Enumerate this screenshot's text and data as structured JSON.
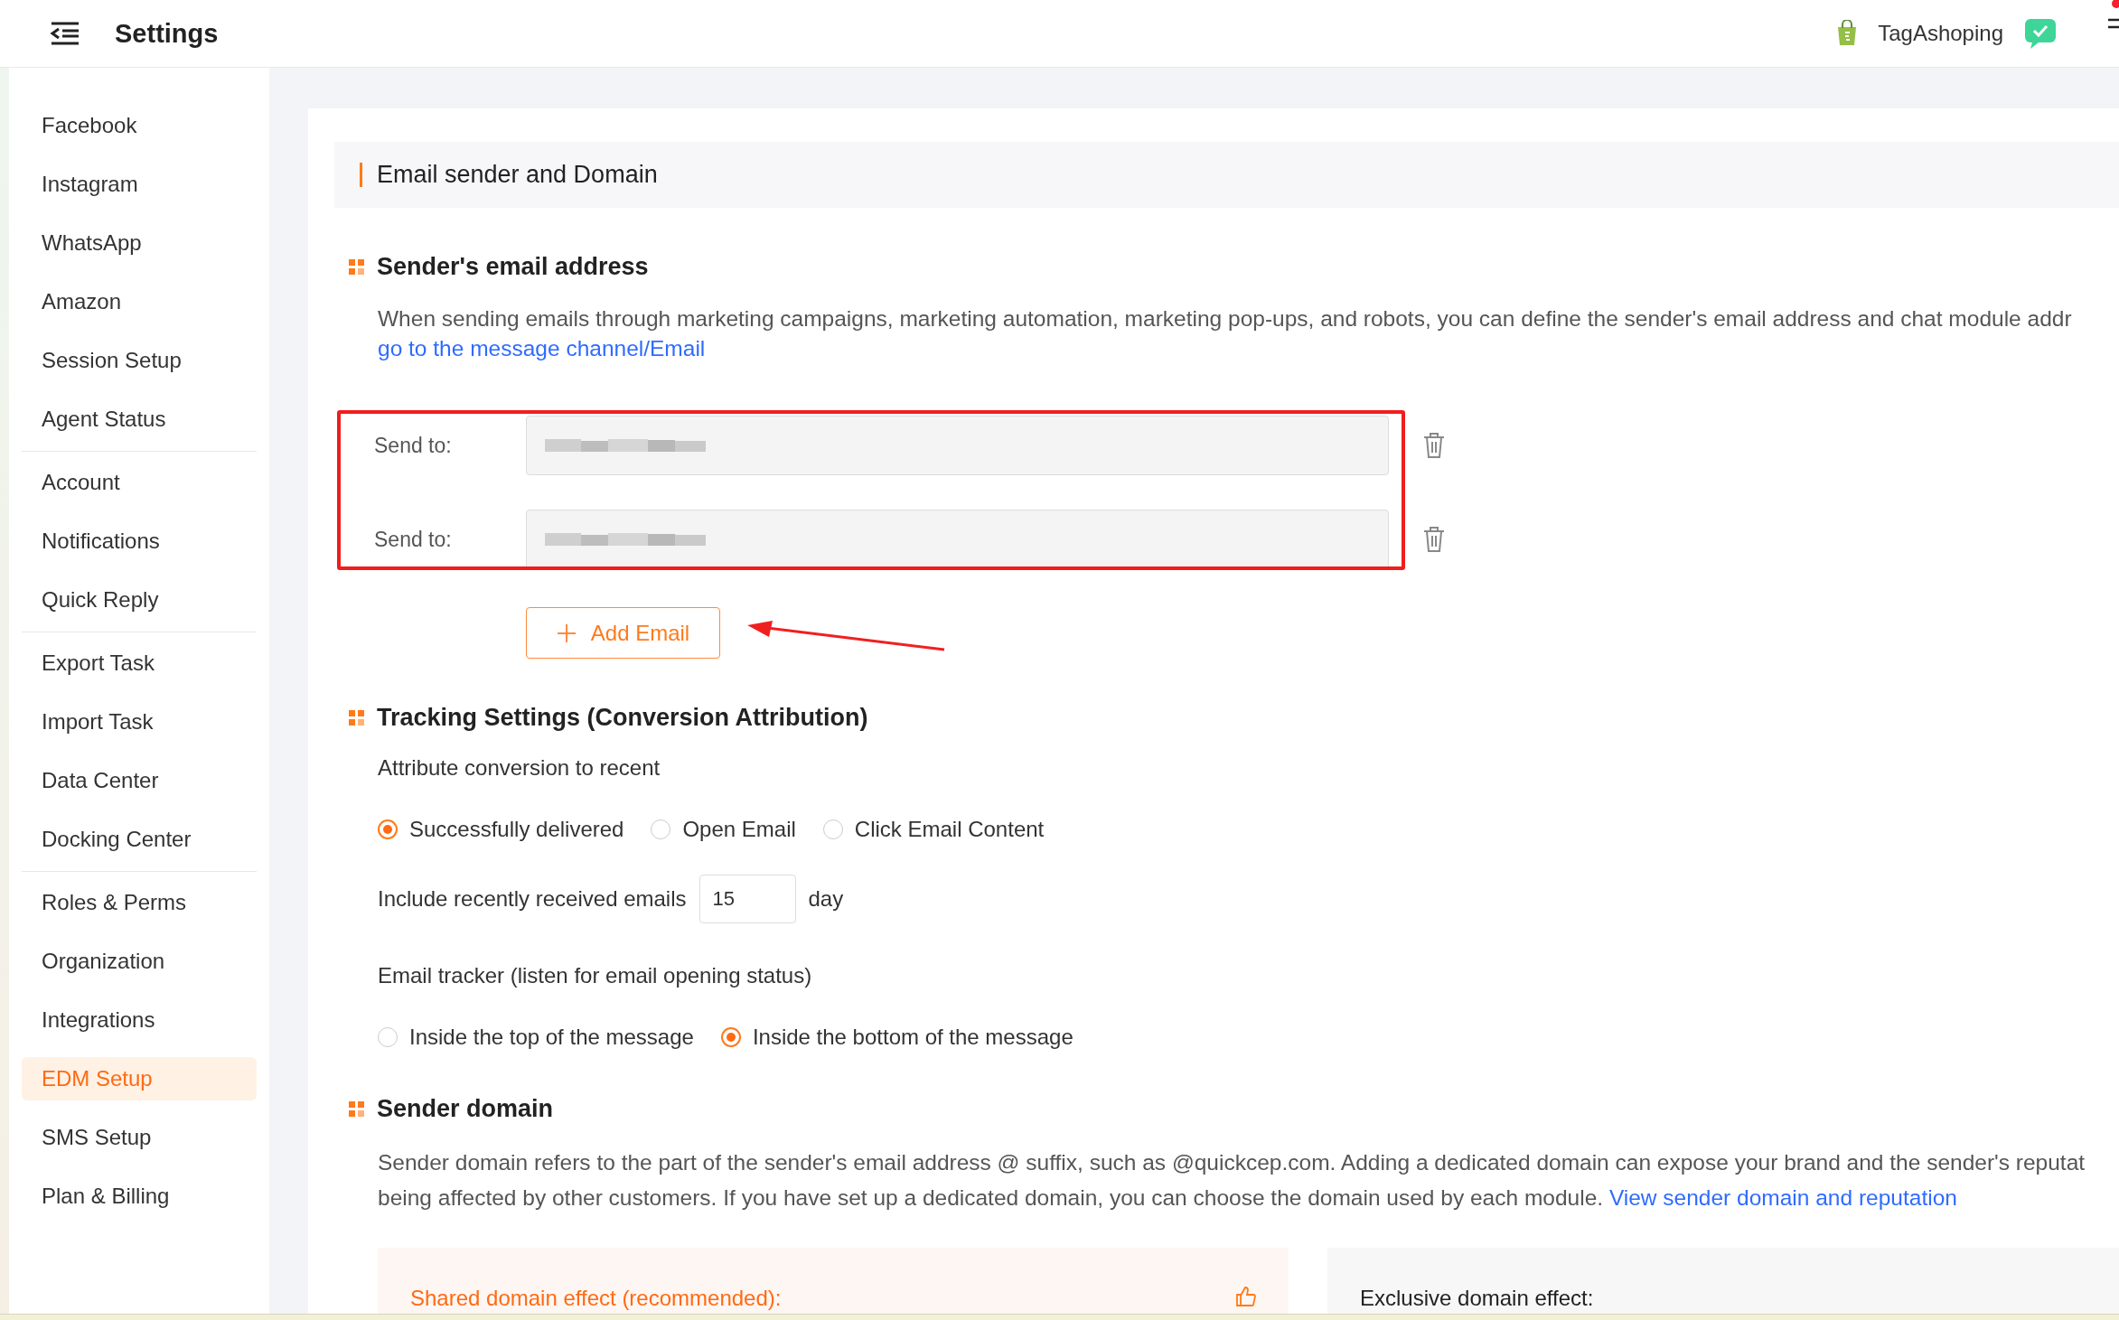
{
  "header": {
    "title": "Settings",
    "store_name": "TagAshoping"
  },
  "sidebar": {
    "groups": [
      {
        "items": [
          {
            "label": "Facebook",
            "selected": false
          },
          {
            "label": "Instagram",
            "selected": false
          },
          {
            "label": "WhatsApp",
            "selected": false
          },
          {
            "label": "Amazon",
            "selected": false
          },
          {
            "label": "Session Setup",
            "selected": false
          },
          {
            "label": "Agent Status",
            "selected": false
          }
        ]
      },
      {
        "items": [
          {
            "label": "Account",
            "selected": false
          },
          {
            "label": "Notifications",
            "selected": false
          },
          {
            "label": "Quick Reply",
            "selected": false
          }
        ]
      },
      {
        "items": [
          {
            "label": "Export Task",
            "selected": false
          },
          {
            "label": "Import Task",
            "selected": false
          },
          {
            "label": "Data Center",
            "selected": false
          },
          {
            "label": "Docking Center",
            "selected": false
          }
        ]
      },
      {
        "items": [
          {
            "label": "Roles & Perms",
            "selected": false
          },
          {
            "label": "Organization",
            "selected": false
          },
          {
            "label": "Integrations",
            "selected": false
          },
          {
            "label": "EDM Setup",
            "selected": true
          },
          {
            "label": "SMS Setup",
            "selected": false
          },
          {
            "label": "Plan & Billing",
            "selected": false
          }
        ]
      }
    ]
  },
  "section_title": "Email sender and Domain",
  "sender_email": {
    "heading": "Sender's email address",
    "description": "When sending emails through marketing campaigns, marketing automation, marketing pop-ups, and robots, you can define the sender's email address and chat module addr",
    "link": "go to the message channel/Email",
    "rows": [
      {
        "label": "Send to:"
      },
      {
        "label": "Send to:"
      }
    ],
    "add_button": "Add Email"
  },
  "tracking": {
    "heading": "Tracking Settings (Conversion Attribution)",
    "attribute_label": "Attribute conversion to recent",
    "attribution_options": [
      {
        "label": "Successfully delivered",
        "selected": true
      },
      {
        "label": "Open Email",
        "selected": false
      },
      {
        "label": "Click Email Content",
        "selected": false
      }
    ],
    "recent_label": "Include recently received emails",
    "recent_days": "15",
    "days_unit": "day",
    "tracker_label": "Email tracker (listen for email opening status)",
    "tracker_options": [
      {
        "label": "Inside the top of the message",
        "selected": false
      },
      {
        "label": "Inside the bottom of the message",
        "selected": true
      }
    ]
  },
  "domain": {
    "heading": "Sender domain",
    "description": "Sender domain refers to the part of the sender's email address @ suffix, such as @quickcep.com. Adding a dedicated domain can expose your brand and the sender's reputat\nbeing affected by other customers. If you have set up a dedicated domain, you can choose the domain used by each module. ",
    "link": "View sender domain and reputation",
    "cards": [
      {
        "kind": "shared",
        "title": "Shared domain effect (recommended):"
      },
      {
        "kind": "exclusive",
        "title": "Exclusive domain effect:"
      }
    ]
  }
}
